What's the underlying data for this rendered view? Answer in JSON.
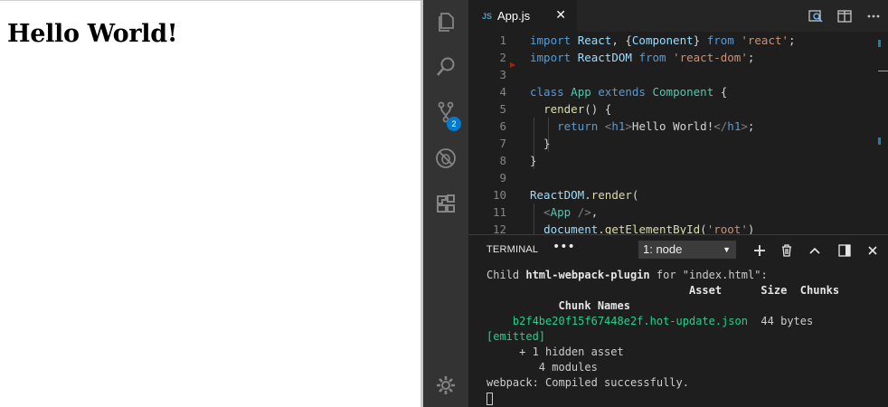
{
  "browser": {
    "heading": "Hello World!"
  },
  "activity_bar": {
    "items": [
      {
        "name": "explorer-icon"
      },
      {
        "name": "search-icon"
      },
      {
        "name": "source-control-icon",
        "badge": "2"
      },
      {
        "name": "debug-icon"
      },
      {
        "name": "extensions-icon"
      }
    ],
    "settings": "gear-icon"
  },
  "tabs": [
    {
      "icon": "JS",
      "label": "App.js",
      "close": "✕"
    }
  ],
  "tab_actions": [
    "open-changes-icon",
    "split-editor-icon",
    "more-actions-icon"
  ],
  "editor": {
    "line_numbers": [
      "1",
      "2",
      "3",
      "4",
      "5",
      "6",
      "7",
      "8",
      "9",
      "10",
      "11",
      "12"
    ]
  },
  "panel": {
    "title": "TERMINAL",
    "more": "•••",
    "terminal_select": "1: node",
    "actions": [
      "add-icon",
      "trash-icon",
      "chevron-up-icon",
      "split-panel-icon",
      "close-icon"
    ],
    "output": {
      "l1a": "Child ",
      "l1b": "html-webpack-plugin",
      "l1c": " for \"index.html\":",
      "l2": "                               Asset      Size  Chunks",
      "l3": "           Chunk Names",
      "l4a": "    b2f4be20f15f67448e2f.hot-update.json",
      "l4b": "  44 bytes",
      "l5": "[emitted]",
      "l6": "     + 1 hidden asset",
      "l7": "        4 modules",
      "l8": "webpack: Compiled successfully."
    }
  },
  "colors": {
    "accent": "#007acc",
    "badge": "#007acc",
    "terminal_green": "#23d18b"
  }
}
